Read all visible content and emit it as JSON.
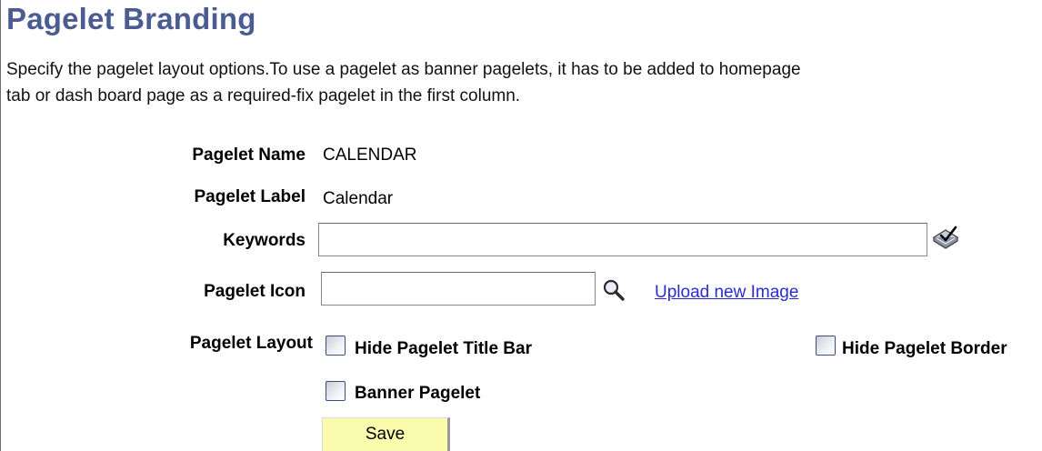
{
  "page": {
    "title": "Pagelet Branding",
    "instructions_line1": "Specify the pagelet layout options.To use a pagelet as banner pagelets, it has to be added to homepage",
    "instructions_line2": "tab or dash board page as a required-fix pagelet in the first column."
  },
  "form": {
    "pagelet_name": {
      "label": "Pagelet Name",
      "value": "CALENDAR"
    },
    "pagelet_label": {
      "label": "Pagelet Label",
      "value": "Calendar"
    },
    "keywords": {
      "label": "Keywords",
      "value": "",
      "icon": "spellcheck-icon"
    },
    "pagelet_icon": {
      "label": "Pagelet Icon",
      "value": "",
      "lookup_icon": "magnifier-icon",
      "upload_link": "Upload new Image"
    },
    "pagelet_layout": {
      "label": "Pagelet Layout",
      "options": [
        {
          "label": "Hide Pagelet Title Bar",
          "checked": false
        },
        {
          "label": "Hide Pagelet Border",
          "checked": false
        },
        {
          "label": "Banner Pagelet",
          "checked": false
        }
      ]
    },
    "save_label": "Save"
  },
  "colors": {
    "title": "#4a5c92",
    "link": "#2b2bd6",
    "save_button": "#fbfbae"
  }
}
